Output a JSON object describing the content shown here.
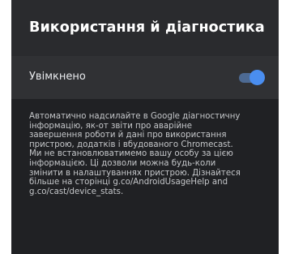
{
  "header": {
    "title": "Використання й діагностика"
  },
  "setting": {
    "label": "Увімкнено",
    "toggle_on": true
  },
  "description": {
    "lines": [
      "Автоматично надсилайте в Google діагностичну",
      "інформацію, як-от звіти про аварійне",
      "завершення роботи й дані про використання",
      "пристрою, додатків і вбудованого Chromecast.",
      "Ми не встановлюватимемо вашу особу за цією",
      "інформацією. Ці дозволи можна будь-коли",
      "змінити в налаштуваннях пристрою. Дізнайтеся",
      "більше на сторінці g.co/AndroidUsageHelp and",
      "g.co/cast/device_stats."
    ]
  },
  "colors": {
    "panel_background": "#202124",
    "header_background": "#2a2b2e",
    "row_background": "#303134",
    "accent": "#4a8ef0"
  }
}
